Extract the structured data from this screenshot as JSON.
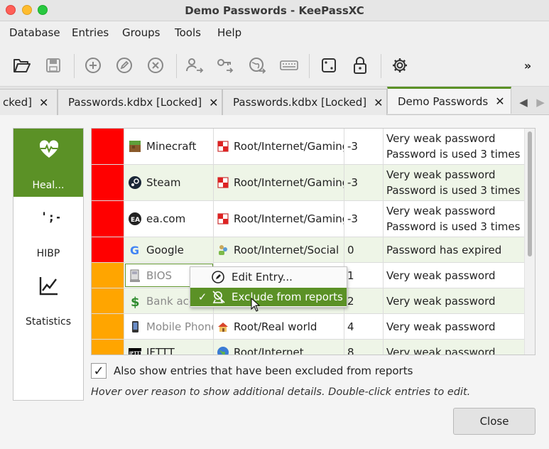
{
  "window": {
    "title": "Demo Passwords - KeePassXC"
  },
  "menu": [
    "Database",
    "Entries",
    "Groups",
    "Tools",
    "Help"
  ],
  "toolbar": {
    "overflow": "»"
  },
  "tabs": [
    {
      "label": "cked]",
      "close": "✕"
    },
    {
      "label": "Passwords.kdbx [Locked]",
      "close": "✕"
    },
    {
      "label": "Passwords.kdbx [Locked]",
      "close": "✕"
    },
    {
      "label": "Demo Passwords",
      "close": "✕"
    }
  ],
  "sidebar": [
    {
      "label": "Heal...",
      "icon": "heart-pulse-icon",
      "selected": true
    },
    {
      "label": "HIBP",
      "icon": "hibp-icon"
    },
    {
      "label": "Statistics",
      "icon": "chart-line-icon"
    }
  ],
  "colors": {
    "accent": "#5b9126",
    "critical": "#ff0000",
    "warning": "#ffa500"
  },
  "rows": [
    {
      "severity_color": "#ff0000",
      "name": "Minecraft",
      "path": "Root/Internet/Gaming",
      "score": "-3",
      "reason1": "Very weak password",
      "reason2": "Password is used 3 times",
      "excluded": false
    },
    {
      "severity_color": "#ff0000",
      "name": "Steam",
      "path": "Root/Internet/Gaming",
      "score": "-3",
      "reason1": "Very weak password",
      "reason2": "Password is used 3 times",
      "excluded": false
    },
    {
      "severity_color": "#ff0000",
      "name": "ea.com",
      "path": "Root/Internet/Gaming",
      "score": "-3",
      "reason1": "Very weak password",
      "reason2": "Password is used 3 times",
      "excluded": false
    },
    {
      "severity_color": "#ff0000",
      "name": "Google",
      "path": "Root/Internet/Social",
      "score": "0",
      "reason1": "Password has expired",
      "reason2": "",
      "excluded": false
    },
    {
      "severity_color": "#ffa500",
      "name": "BIOS",
      "path": "",
      "score": "1",
      "reason1": "Very weak password",
      "reason2": "",
      "excluded": true
    },
    {
      "severity_color": "#ffa500",
      "name": "Bank acco",
      "path": "",
      "score": "2",
      "reason1": "Very weak password",
      "reason2": "",
      "excluded": true
    },
    {
      "severity_color": "#ffa500",
      "name": "Mobile Phone",
      "path": "Root/Real world",
      "score": "4",
      "reason1": "Very weak password",
      "reason2": "",
      "excluded": true
    },
    {
      "severity_color": "#ffa500",
      "name": "IFTTT",
      "path": "Root/Internet",
      "score": "8",
      "reason1": "Very weak password",
      "reason2": "",
      "excluded": false
    }
  ],
  "context_menu": {
    "edit_label": "Edit Entry...",
    "exclude_label": "Exclude from reports",
    "exclude_check": "✓"
  },
  "options": {
    "show_excluded_label": "Also show entries that have been excluded from reports",
    "show_excluded_checked": "✓"
  },
  "hint": "Hover over reason to show additional details. Double-click entries to edit.",
  "buttons": {
    "close": "Close"
  }
}
